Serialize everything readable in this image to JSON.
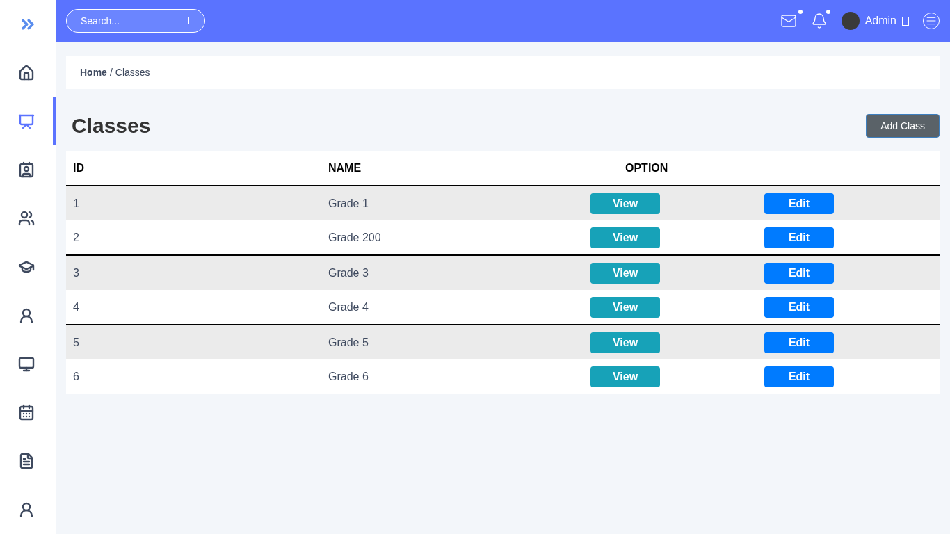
{
  "sidebar": {
    "items": [
      {
        "kind": "home",
        "selected": false
      },
      {
        "kind": "teacher",
        "selected": true
      },
      {
        "kind": "contacts",
        "selected": false
      },
      {
        "kind": "users",
        "selected": false
      },
      {
        "kind": "graduate",
        "selected": false
      },
      {
        "kind": "person",
        "selected": false
      },
      {
        "kind": "board",
        "selected": false
      },
      {
        "kind": "calendar",
        "selected": false
      },
      {
        "kind": "invoice",
        "selected": false
      },
      {
        "kind": "person",
        "selected": false
      }
    ]
  },
  "topbar": {
    "search": {
      "placeholder": "Search..."
    },
    "user": {
      "name": "Admin"
    },
    "mail_unread": true,
    "notifications_unread": true
  },
  "breadcrumb": {
    "home": "Home",
    "separator": "/",
    "current": "Classes"
  },
  "page": {
    "title": "Classes",
    "add_button": "Add Class"
  },
  "table": {
    "columns": [
      "ID",
      "NAME",
      "OPTION"
    ],
    "rows": [
      {
        "id": "1",
        "name": "Grade 1",
        "view": "View",
        "edit": "Edit"
      },
      {
        "id": "2",
        "name": "Grade 200",
        "view": "View",
        "edit": "Edit"
      },
      {
        "id": "3",
        "name": "Grade 3",
        "view": "View",
        "edit": "Edit"
      },
      {
        "id": "4",
        "name": "Grade 4",
        "view": "View",
        "edit": "Edit"
      },
      {
        "id": "5",
        "name": "Grade 5",
        "view": "View",
        "edit": "Edit"
      },
      {
        "id": "6",
        "name": "Grade 6",
        "view": "View",
        "edit": "Edit"
      }
    ]
  }
}
